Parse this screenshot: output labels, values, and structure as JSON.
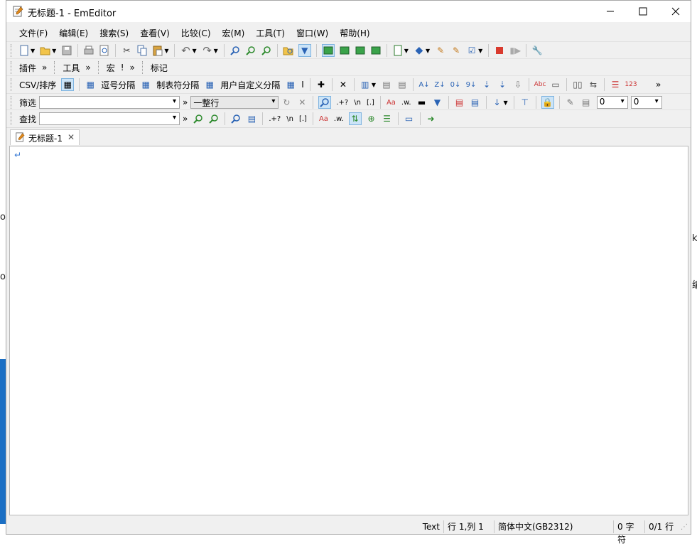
{
  "window": {
    "title": "无标题-1 - EmEditor"
  },
  "menu": [
    "文件(F)",
    "编辑(E)",
    "搜索(S)",
    "查看(V)",
    "比较(C)",
    "宏(M)",
    "工具(T)",
    "窗口(W)",
    "帮助(H)"
  ],
  "toolbar_tabs": {
    "plugins": "插件",
    "tools": "工具",
    "macros": "宏",
    "marker": "标记",
    "macros_extra": "!"
  },
  "csv_bar": {
    "csv_sort": "CSV/排序",
    "comma": "逗号分隔",
    "tab": "制表符分隔",
    "user": "用户自定义分隔",
    "user_extra": "I"
  },
  "filter_bar": {
    "label": "筛选",
    "scope_value": "一整行",
    "num1": "0",
    "num2": "0"
  },
  "find_bar": {
    "label": "查找"
  },
  "doc_tab": {
    "title": "无标题-1"
  },
  "editor": {
    "eol_mark": "↵"
  },
  "status": {
    "mode": "Text",
    "position": "行 1,列 1",
    "encoding": "简体中文(GB2312)",
    "chars": "0 字符",
    "lines": "0/1 行"
  },
  "regex_tokens": {
    "regex": ".+?",
    "newline": "\\n",
    "bracket": "[.]",
    "case": "Aa",
    "word": ".w."
  }
}
